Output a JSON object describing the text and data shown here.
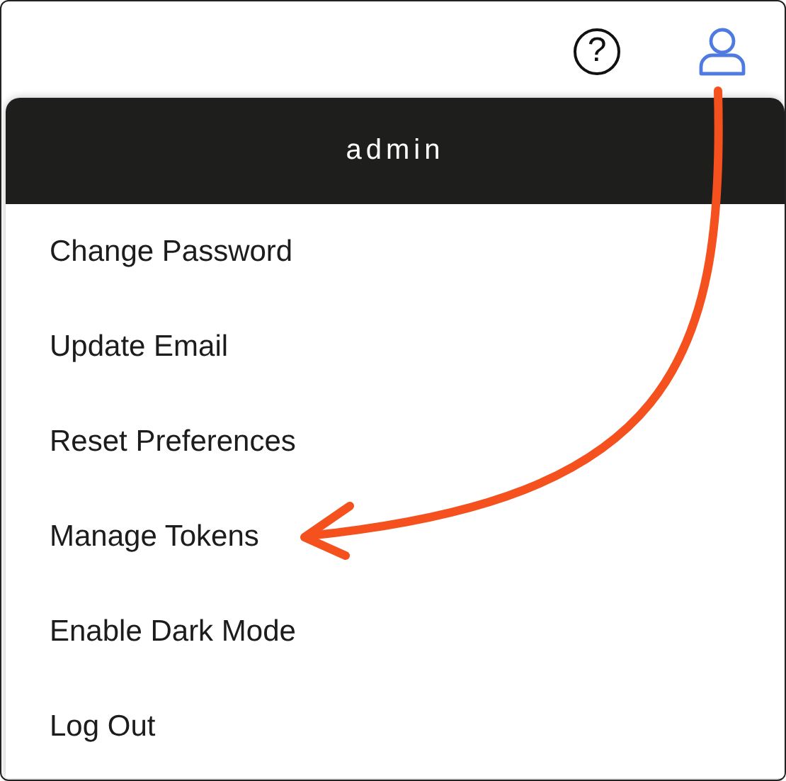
{
  "header": {
    "help_glyph": "?"
  },
  "menu": {
    "title": "admin",
    "items": [
      {
        "label": "Change Password"
      },
      {
        "label": "Update Email"
      },
      {
        "label": "Reset Preferences"
      },
      {
        "label": "Manage Tokens"
      },
      {
        "label": "Enable Dark Mode"
      },
      {
        "label": "Log Out"
      }
    ]
  }
}
